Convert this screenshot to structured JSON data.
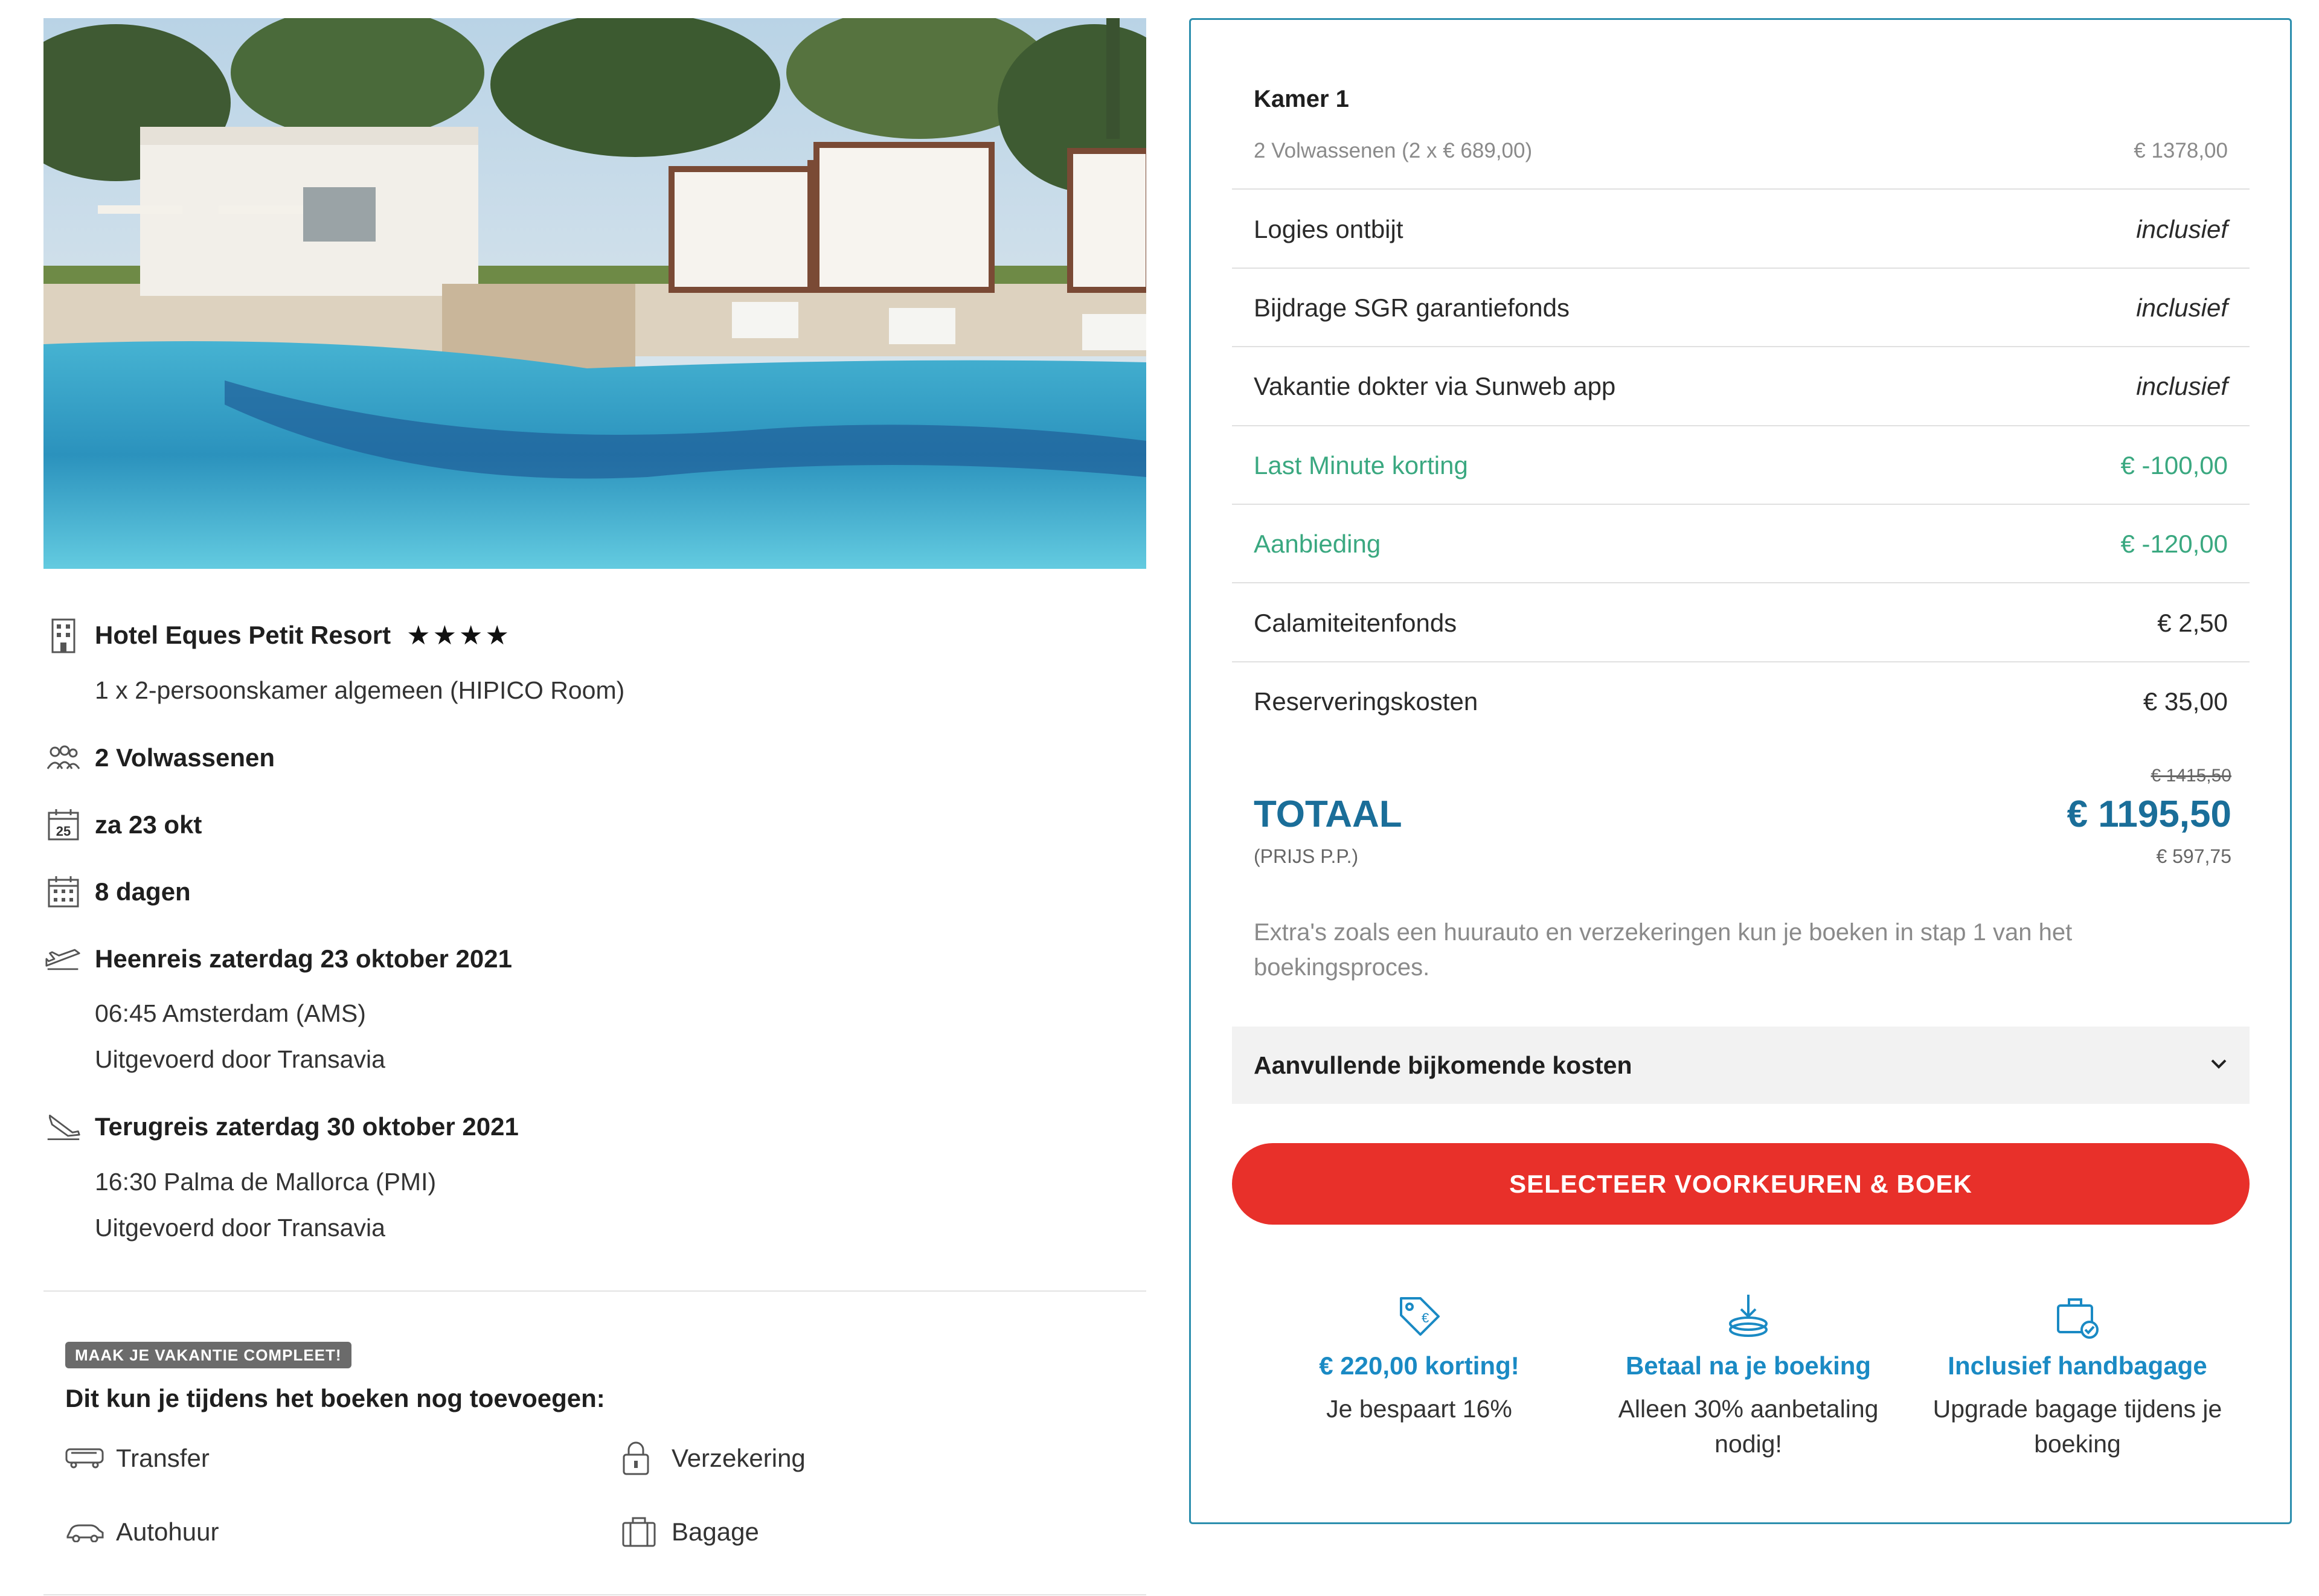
{
  "hotel": {
    "name": "Hotel Eques Petit Resort",
    "stars": 4,
    "room": "1 x 2-persoonskamer algemeen (HIPICO Room)"
  },
  "trip": {
    "travelers": "2 Volwassenen",
    "date": "za 23 okt",
    "date_icon_number": "25",
    "duration": "8 dagen",
    "outbound_title": "Heenreis zaterdag 23 oktober 2021",
    "outbound_time": "06:45 Amsterdam (AMS)",
    "outbound_carrier": "Uitgevoerd door Transavia",
    "return_title": "Terugreis zaterdag 30 oktober 2021",
    "return_time": "16:30 Palma de Mallorca (PMI)",
    "return_carrier": "Uitgevoerd door Transavia"
  },
  "extras": {
    "badge": "MAAK JE VAKANTIE COMPLEET!",
    "heading": "Dit kun je tijdens het boeken nog toevoegen:",
    "items": [
      "Transfer",
      "Verzekering",
      "Autohuur",
      "Bagage"
    ]
  },
  "summary": {
    "room_title": "Kamer 1",
    "room_detail": "2 Volwassenen (2 x € 689,00)",
    "room_price": "€ 1378,00",
    "lines": [
      {
        "label": "Logies ontbijt",
        "value": "inclusief"
      },
      {
        "label": "Bijdrage SGR garantiefonds",
        "value": "inclusief"
      },
      {
        "label": "Vakantie dokter via Sunweb app",
        "value": "inclusief"
      },
      {
        "label": "Last Minute korting",
        "value": "€ -100,00"
      },
      {
        "label": "Aanbieding",
        "value": "€ -120,00"
      },
      {
        "label": "Calamiteitenfonds",
        "value": "€ 2,50"
      },
      {
        "label": "Reserveringskosten",
        "value": "€ 35,00"
      }
    ],
    "total_label": "TOTAAL",
    "total_sub": "(PRIJS P.P.)",
    "old_total": "€ 1415,50",
    "total": "€ 1195,50",
    "per_person": "€ 597,75",
    "note": "Extra's zoals een huurauto en verzekeringen kun je boeken in stap 1 van het boekingsproces.",
    "accordion": "Aanvullende bijkomende kosten",
    "cta": "SELECTEER VOORKEUREN & BOEK"
  },
  "usps": [
    {
      "title": "€ 220,00 korting!",
      "desc": "Je bespaart 16%"
    },
    {
      "title": "Betaal na je boeking",
      "desc": "Alleen 30% aanbetaling nodig!"
    },
    {
      "title": "Inclusief handbagage",
      "desc": "Upgrade bagage tijdens je boeking"
    }
  ],
  "colors": {
    "accent_blue": "#1a8ac4",
    "total_blue": "#1a6e99",
    "discount_green": "#3aa880",
    "cta_red": "#e8302a",
    "card_border": "#2d8fae"
  }
}
